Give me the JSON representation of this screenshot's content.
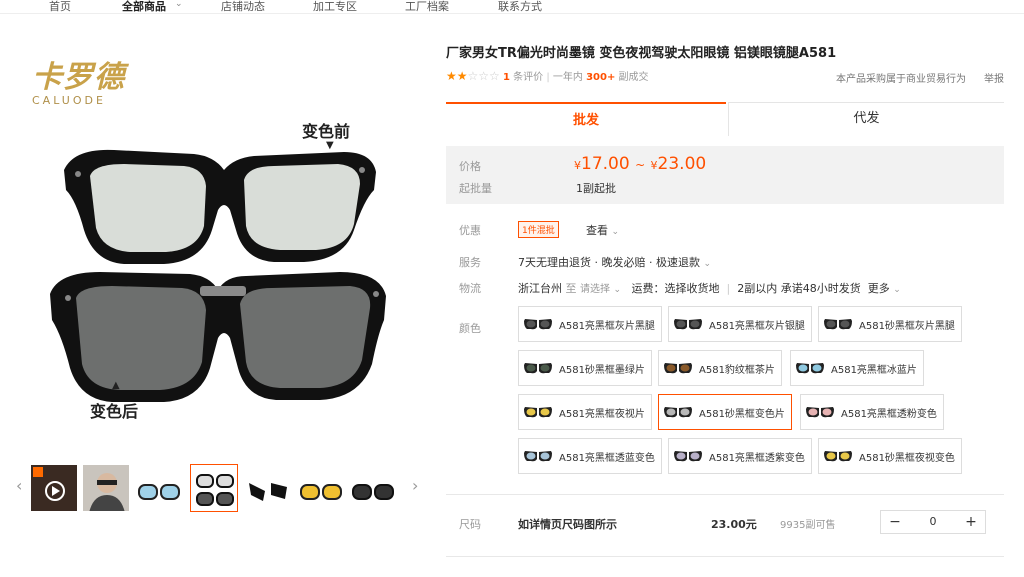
{
  "nav": {
    "items": [
      {
        "label": "首页",
        "active": false
      },
      {
        "label": "全部商品",
        "active": true
      },
      {
        "label": "店铺动态",
        "active": false
      },
      {
        "label": "加工专区",
        "active": false
      },
      {
        "label": "工厂档案",
        "active": false
      },
      {
        "label": "联系方式",
        "active": false
      }
    ],
    "dropdown_icon": "chevron-down-icon"
  },
  "gallery": {
    "brand_cn": "卡罗德",
    "brand_en": "CALUODE",
    "caption_before": "变色前",
    "caption_after": "变色后",
    "prev_icon": "chevron-left-icon",
    "next_icon": "chevron-right-icon",
    "thumbnails": [
      "video-thumb",
      "model-thumb",
      "blue-lens-thumb",
      "before-after-thumb",
      "black-frame-thumb",
      "yellow-lens-thumb",
      "dark-lens-thumb"
    ],
    "selected_thumbnail": 3
  },
  "product": {
    "title": "厂家男女TR偏光时尚墨镜 变色夜视驾驶太阳眼镜 铝镁眼镜腿A581",
    "rating": 2,
    "rating_max": 5,
    "review_count": "1",
    "review_label": "条评价",
    "sales_prefix": "一年内",
    "sales_count": "300+",
    "sales_suffix": "副成交",
    "trade_note": "本产品采购属于商业贸易行为",
    "report": "举报"
  },
  "tabs": {
    "wholesale": "批发",
    "dropship": "代发"
  },
  "price": {
    "label": "价格",
    "currency": "¥",
    "min": "17.00",
    "max": "23.00",
    "range_sep": "~",
    "moq_label": "起批量",
    "moq": "1副起批"
  },
  "promo": {
    "label": "优惠",
    "badge": "1件混批",
    "view": "查看"
  },
  "service": {
    "label": "服务",
    "text": "7天无理由退货 · 晚发必赔 · 极速退款"
  },
  "logistics": {
    "label": "物流",
    "origin": "浙江台州",
    "to": "至",
    "select": "请选择",
    "freight": "运费：选择收货地",
    "promise": "2副以内 承诺48小时发货",
    "more": "更多"
  },
  "colors": {
    "label": "颜色",
    "selected": 7,
    "options": [
      {
        "name": "A581亮黑框灰片黑腿",
        "lens": "#555555"
      },
      {
        "name": "A581亮黑框灰片银腿",
        "lens": "#555555"
      },
      {
        "name": "A581砂黑框灰片黑腿",
        "lens": "#555555"
      },
      {
        "name": "A581砂黑框墨绿片",
        "lens": "#4a5a4a"
      },
      {
        "name": "A581豹纹框茶片",
        "lens": "#8a5a2a"
      },
      {
        "name": "A581亮黑框冰蓝片",
        "lens": "#8fc9e0"
      },
      {
        "name": "A581亮黑框夜视片",
        "lens": "#e8c84a"
      },
      {
        "name": "A581砂黑框变色片",
        "lens": "#b8b8b8"
      },
      {
        "name": "A581亮黑框透粉变色",
        "lens": "#e8b4b4"
      },
      {
        "name": "A581亮黑框透蓝变色",
        "lens": "#a8c4d8"
      },
      {
        "name": "A581亮黑框透紫变色",
        "lens": "#b8b0c8"
      },
      {
        "name": "A581砂黑框夜视变色",
        "lens": "#e8c84a"
      }
    ]
  },
  "size": {
    "label": "尺码",
    "value": "如详情页尺码图所示",
    "price": "23.00元",
    "stock": "9935副可售",
    "qty": "0",
    "minus": "−",
    "plus": "+"
  }
}
